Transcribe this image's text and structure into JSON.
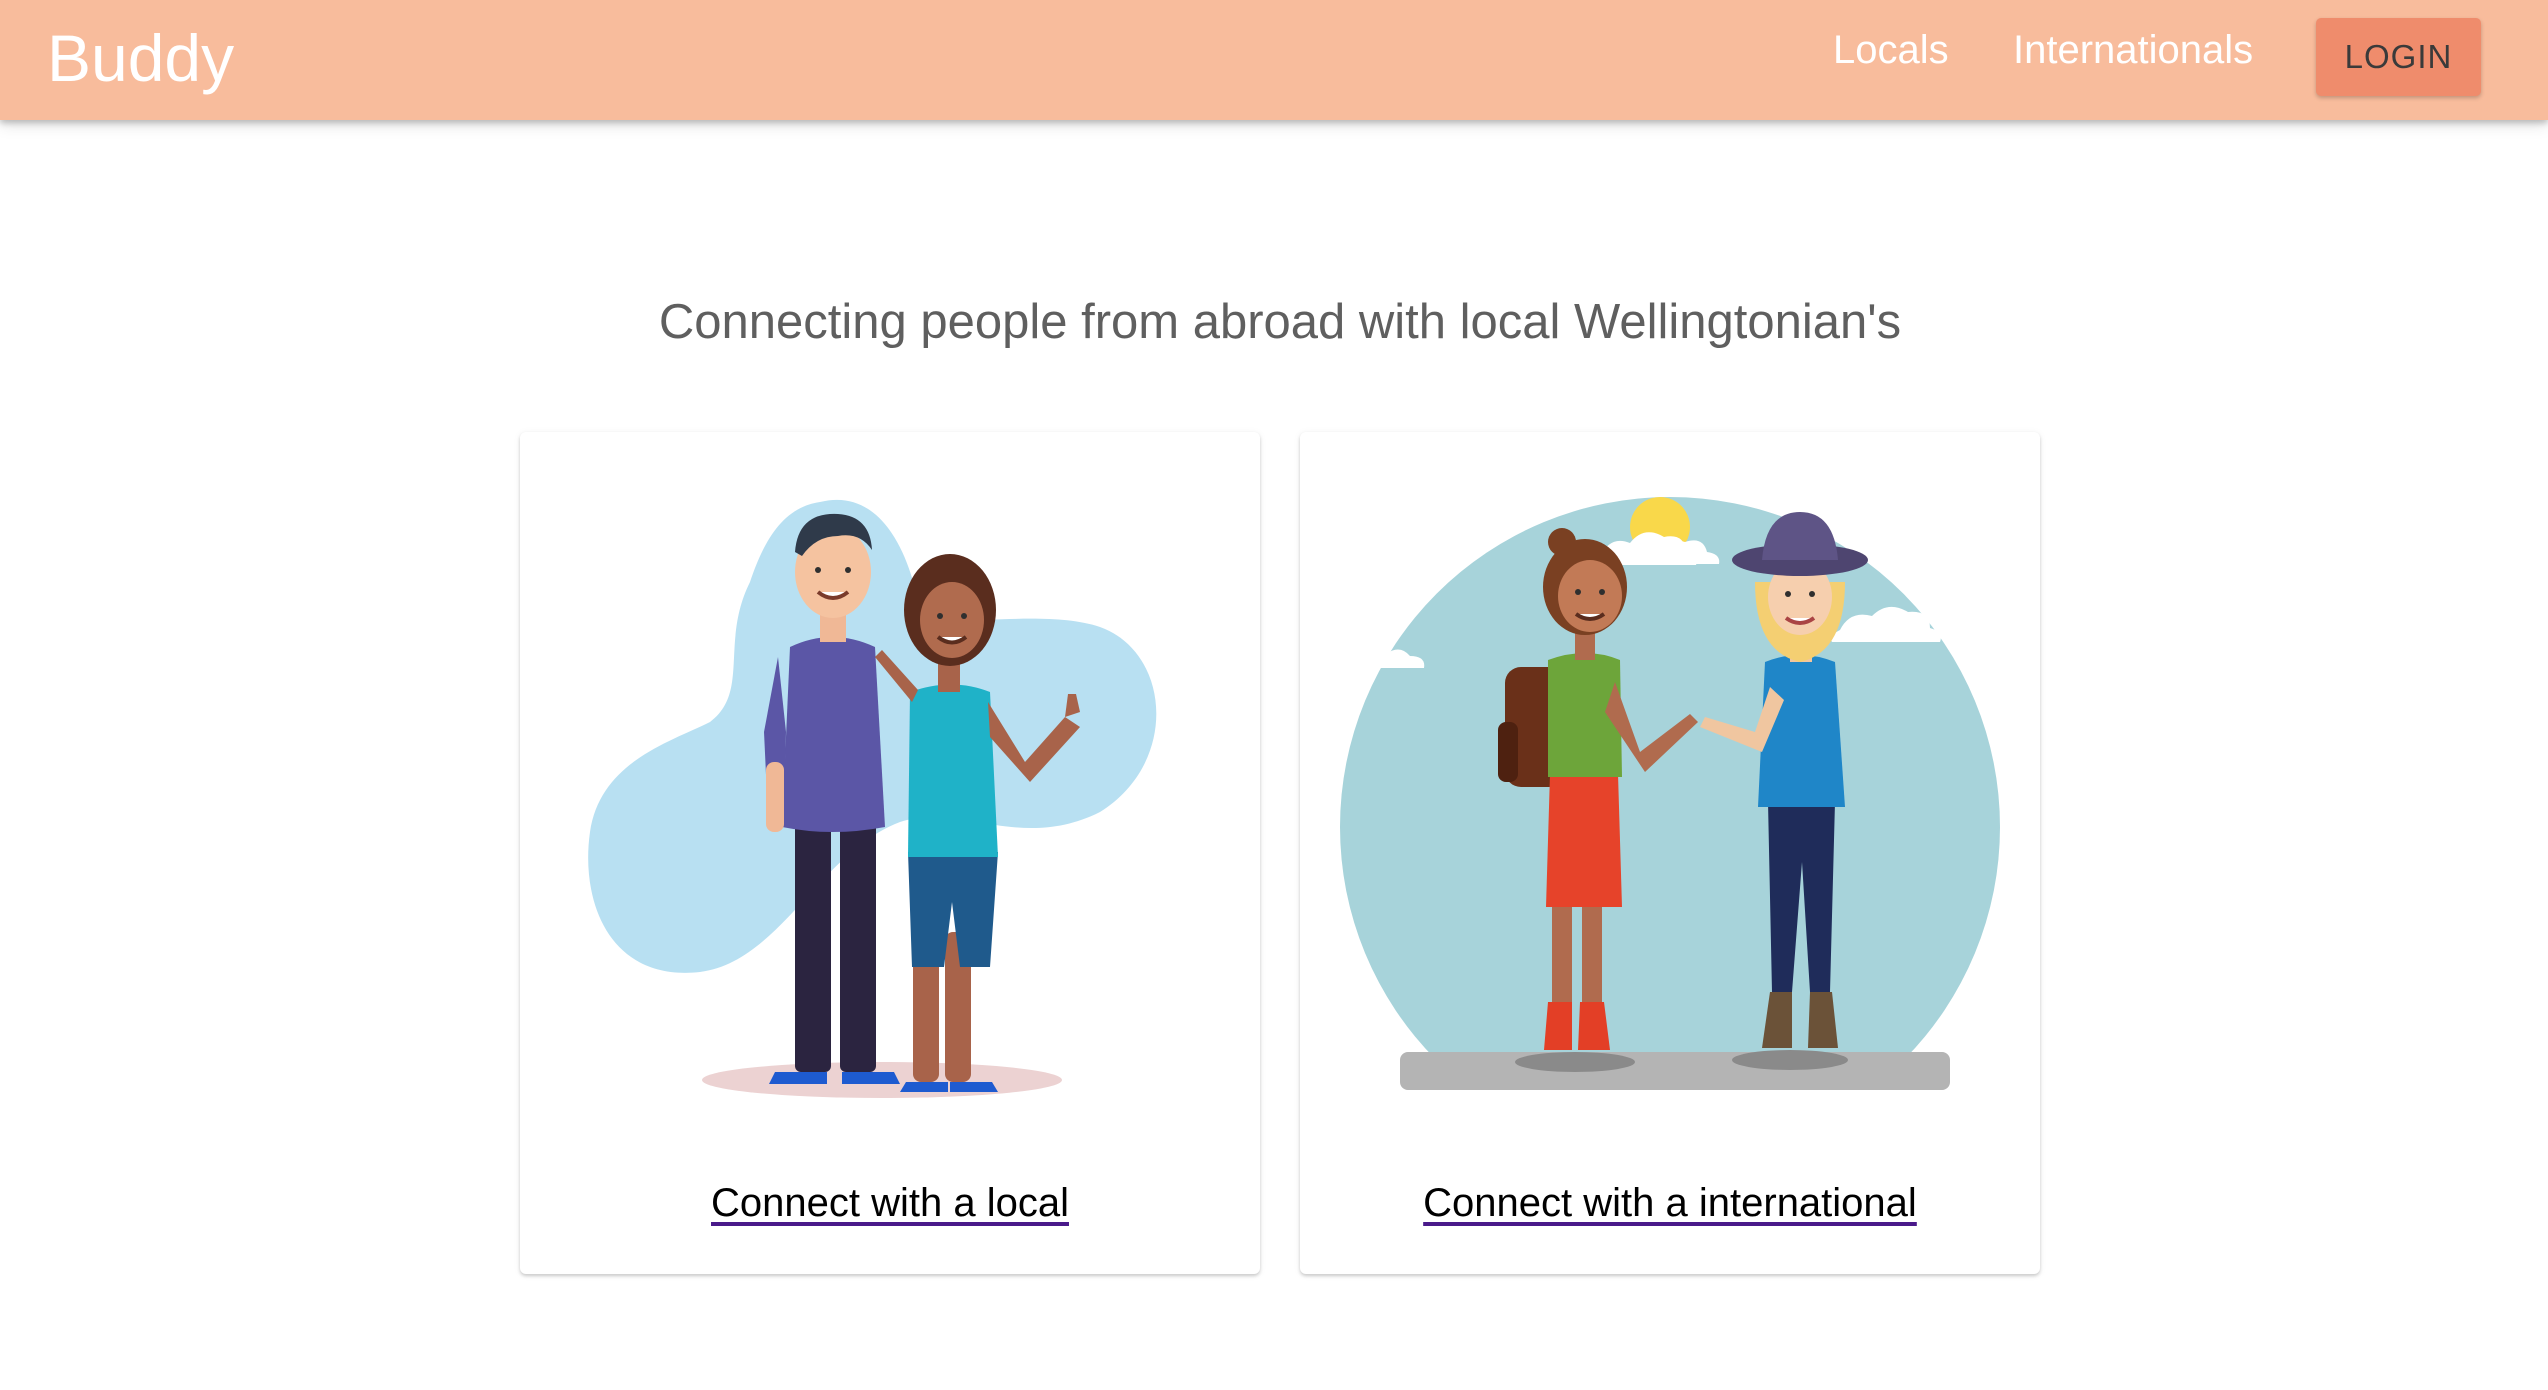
{
  "app": {
    "brand": "Buddy"
  },
  "nav": {
    "locals": "Locals",
    "internationals": "Internationals",
    "login": "LOGIN"
  },
  "main": {
    "tagline": "Connecting people from abroad with local Wellingtonian's",
    "cards": [
      {
        "link": "Connect with a local",
        "illustration": "two-friends-illustration"
      },
      {
        "link": "Connect with a international",
        "illustration": "travelers-meeting-illustration"
      }
    ]
  },
  "colors": {
    "appbar": "#f8bc9c",
    "login_button": "#ef8c6c",
    "tagline_text": "#5f5f5f"
  }
}
